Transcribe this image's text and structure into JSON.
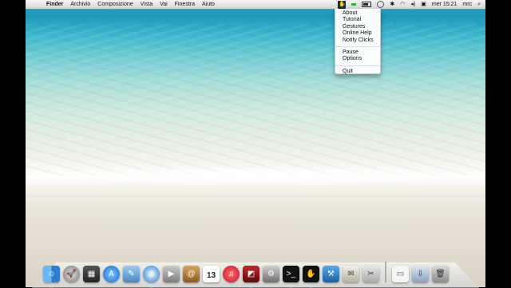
{
  "menubar": {
    "app_name": "Finder",
    "items": [
      "Archivio",
      "Composizione",
      "Vista",
      "Vai",
      "Finestra",
      "Aiuto"
    ],
    "clock": "mer 15:21",
    "user": "mrc"
  },
  "extra_menu": {
    "items": [
      "About",
      "Tutorial",
      "Gestures",
      "Online Help",
      "Notify Clicks"
    ],
    "items2": [
      "Pause",
      "Options"
    ],
    "items3": [
      "Quit"
    ]
  },
  "dock": {
    "calendar_day": "13",
    "icons": [
      "finder-icon",
      "launchpad-icon",
      "dashboard-icon",
      "app-store-icon",
      "photo-icon",
      "safari-icon",
      "facetime-icon",
      "address-book-icon",
      "calendar-icon",
      "itunes-icon",
      "photo-booth-icon",
      "system-preferences-icon",
      "terminal-icon",
      "gesture-app-icon",
      "xcode-icon",
      "preview-icon",
      "utility-icon",
      "documents-icon",
      "downloads-icon",
      "trash-icon"
    ]
  }
}
